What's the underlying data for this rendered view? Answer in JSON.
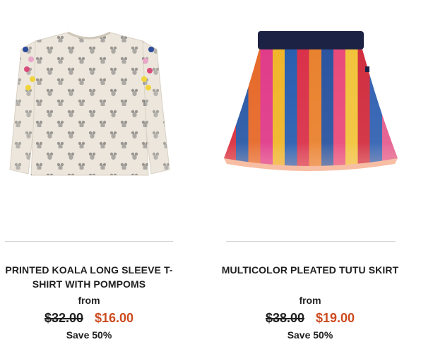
{
  "products": [
    {
      "name": "PRINTED KOALA LONG SLEEVE T-SHIRT WITH POMPOMS",
      "from_label": "from",
      "original_price": "$32.00",
      "sale_price": "$16.00",
      "save_label": "Save 50%",
      "sale_color": "#cc4b1f",
      "image_icon": "koala-tshirt-image"
    },
    {
      "name": "MULTICOLOR PLEATED TUTU SKIRT",
      "from_label": "from",
      "original_price": "$38.00",
      "sale_price": "$19.00",
      "save_label": "Save 50%",
      "sale_color": "#cc4b1f",
      "image_icon": "tutu-skirt-image"
    }
  ]
}
